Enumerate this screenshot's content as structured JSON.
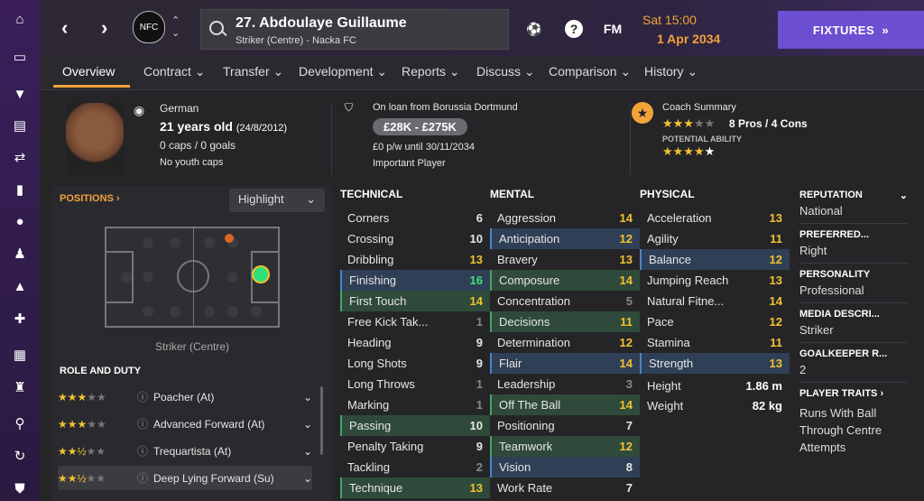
{
  "topbar": {
    "player_name": "27. Abdoulaye Guillaume",
    "player_sub": "Striker (Centre) - Nacka FC",
    "club_abbr": "NFC",
    "help": "?",
    "fm": "FM",
    "date_line1": "Sat 15:00",
    "date_line2": "1 Apr 2034",
    "fixtures_label": "FIXTURES"
  },
  "tabs": [
    "Overview",
    "Contract",
    "Transfer",
    "Development",
    "Reports",
    "Discuss",
    "Comparison",
    "History"
  ],
  "profile": {
    "nationality": "German",
    "age": "21 years old",
    "dob": "(24/8/2012)",
    "caps": "0 caps / 0 goals",
    "youth": "No youth caps",
    "loan": "On loan from Borussia Dortmund",
    "value": "£28K - £275K",
    "wage": "£0 p/w until 30/11/2034",
    "status": "Important Player",
    "coach_title": "Coach Summary",
    "coach_ability_stars": 3,
    "coach_pros": "8 Pros / 4 Cons",
    "potential_label": "POTENTIAL ABILITY",
    "potential_stars": 4
  },
  "positions": {
    "title": "POSITIONS",
    "highlight": "Highlight",
    "position_label": "Striker (Centre)",
    "role_title": "ROLE AND DUTY",
    "roles": [
      {
        "name": "Poacher (At)",
        "stars": 3
      },
      {
        "name": "Advanced Forward (At)",
        "stars": 3
      },
      {
        "name": "Trequartista (At)",
        "stars": 2.5
      },
      {
        "name": "Deep Lying Forward (Su)",
        "stars": 2.5
      }
    ]
  },
  "technical": {
    "title": "TECHNICAL",
    "rows": [
      [
        "Corners",
        "6",
        ""
      ],
      [
        "Crossing",
        "10",
        ""
      ],
      [
        "Dribbling",
        "13",
        "y"
      ],
      [
        "Finishing",
        "16",
        "g",
        "hb"
      ],
      [
        "First Touch",
        "14",
        "y",
        "hl"
      ],
      [
        "Free Kick Tak...",
        "1",
        "gr"
      ],
      [
        "Heading",
        "9",
        ""
      ],
      [
        "Long Shots",
        "9",
        ""
      ],
      [
        "Long Throws",
        "1",
        "gr"
      ],
      [
        "Marking",
        "1",
        "gr"
      ],
      [
        "Passing",
        "10",
        "",
        "hl"
      ],
      [
        "Penalty Taking",
        "9",
        ""
      ],
      [
        "Tackling",
        "2",
        "gr"
      ],
      [
        "Technique",
        "13",
        "y",
        "hl"
      ]
    ]
  },
  "mental": {
    "title": "MENTAL",
    "rows": [
      [
        "Aggression",
        "14",
        "y"
      ],
      [
        "Anticipation",
        "12",
        "y",
        "hb"
      ],
      [
        "Bravery",
        "13",
        "y"
      ],
      [
        "Composure",
        "14",
        "y",
        "hl"
      ],
      [
        "Concentration",
        "5",
        "gr"
      ],
      [
        "Decisions",
        "11",
        "y",
        "hl"
      ],
      [
        "Determination",
        "12",
        "y"
      ],
      [
        "Flair",
        "14",
        "y",
        "hb"
      ],
      [
        "Leadership",
        "3",
        "gr"
      ],
      [
        "Off The Ball",
        "14",
        "y",
        "hl"
      ],
      [
        "Positioning",
        "7",
        ""
      ],
      [
        "Teamwork",
        "12",
        "y",
        "hl"
      ],
      [
        "Vision",
        "8",
        "",
        "hb"
      ],
      [
        "Work Rate",
        "7",
        ""
      ]
    ]
  },
  "physical": {
    "title": "PHYSICAL",
    "rows": [
      [
        "Acceleration",
        "13",
        "y"
      ],
      [
        "Agility",
        "11",
        "y"
      ],
      [
        "Balance",
        "12",
        "y",
        "hb"
      ],
      [
        "Jumping Reach",
        "13",
        "y"
      ],
      [
        "Natural Fitne...",
        "14",
        "y"
      ],
      [
        "Pace",
        "12",
        "y"
      ],
      [
        "Stamina",
        "11",
        "y"
      ],
      [
        "Strength",
        "13",
        "y",
        "hb"
      ]
    ],
    "height_label": "Height",
    "height": "1.86 m",
    "weight_label": "Weight",
    "weight": "82 kg"
  },
  "right": {
    "rep_label": "REPUTATION",
    "rep": "National",
    "foot_label": "PREFERRED...",
    "foot": "Right",
    "pers_label": "PERSONALITY",
    "pers": "Professional",
    "media_label": "MEDIA DESCRI...",
    "media": "Striker",
    "gk_label": "GOALKEEPER R...",
    "gk": "2",
    "traits_label": "PLAYER TRAITS",
    "trait": "Runs With Ball Through Centre",
    "trait2": "Attempts"
  }
}
